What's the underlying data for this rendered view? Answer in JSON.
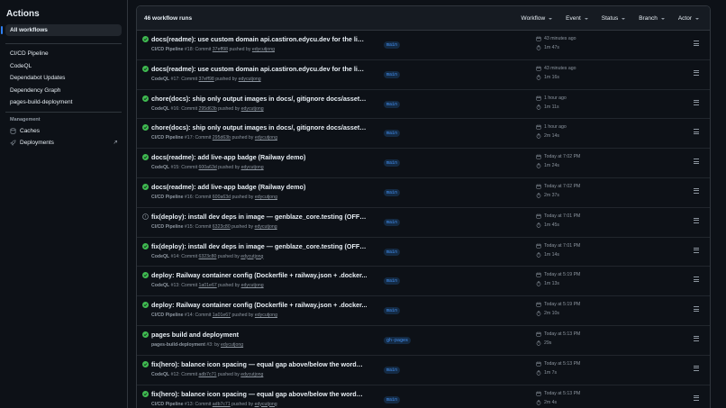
{
  "sidebar": {
    "title": "Actions",
    "all_workflows": "All workflows",
    "workflows": [
      "CI/CD Pipeline",
      "CodeQL",
      "Dependabot Updates",
      "Dependency Graph",
      "pages-build-deployment"
    ],
    "management_title": "Management",
    "management": [
      {
        "label": "Caches",
        "icon": "cache-icon"
      },
      {
        "label": "Deployments",
        "icon": "rocket-icon"
      }
    ]
  },
  "main": {
    "runs_count": "46 workflow runs",
    "filters": [
      "Workflow",
      "Event",
      "Status",
      "Branch",
      "Actor"
    ]
  },
  "runs": [
    {
      "status": "success",
      "title": "docs(readme): use custom domain api.castiron.edycu.dev for the live app",
      "workflow": "CI/CD Pipeline",
      "run": "#18",
      "kind": "Commit",
      "commit": "37eff98",
      "actor": "edycutjong",
      "branch": "main",
      "time": "43 minutes ago",
      "duration": "1m 47s"
    },
    {
      "status": "success",
      "title": "docs(readme): use custom domain api.castiron.edycu.dev for the live app",
      "workflow": "CodeQL",
      "run": "#17",
      "kind": "Commit",
      "commit": "37eff98",
      "actor": "edycutjong",
      "branch": "main",
      "time": "43 minutes ago",
      "duration": "1m 16s"
    },
    {
      "status": "success",
      "title": "chore(docs): ship only output images in docs/, gitignore docs/assets ...",
      "workflow": "CodeQL",
      "run": "#16",
      "kind": "Commit",
      "commit": "295d63b",
      "actor": "edycutjong",
      "branch": "main",
      "time": "1 hour ago",
      "duration": "1m 11s"
    },
    {
      "status": "success",
      "title": "chore(docs): ship only output images in docs/, gitignore docs/assets ...",
      "workflow": "CI/CD Pipeline",
      "run": "#17",
      "kind": "Commit",
      "commit": "295d63b",
      "actor": "edycutjong",
      "branch": "main",
      "time": "1 hour ago",
      "duration": "2m 14s"
    },
    {
      "status": "success",
      "title": "docs(readme): add live-app badge (Railway demo)",
      "workflow": "CodeQL",
      "run": "#15",
      "kind": "Commit",
      "commit": "600a63d",
      "actor": "edycutjong",
      "branch": "main",
      "time": "Today at 7:02 PM",
      "duration": "1m 24s"
    },
    {
      "status": "success",
      "title": "docs(readme): add live-app badge (Railway demo)",
      "workflow": "CI/CD Pipeline",
      "run": "#16",
      "kind": "Commit",
      "commit": "600a63d",
      "actor": "edycutjong",
      "branch": "main",
      "time": "Today at 7:02 PM",
      "duration": "2m 37s"
    },
    {
      "status": "neutral",
      "title": "fix(deploy): install dev deps in image — genblaze_core.testing (OFFLI...",
      "workflow": "CI/CD Pipeline",
      "run": "#15",
      "kind": "Commit",
      "commit": "6323c80",
      "actor": "edycutjong",
      "branch": "main",
      "time": "Today at 7:01 PM",
      "duration": "1m 45s"
    },
    {
      "status": "success",
      "title": "fix(deploy): install dev deps in image — genblaze_core.testing (OFFLI...",
      "workflow": "CodeQL",
      "run": "#14",
      "kind": "Commit",
      "commit": "6323c80",
      "actor": "edycutjong",
      "branch": "main",
      "time": "Today at 7:01 PM",
      "duration": "1m 14s"
    },
    {
      "status": "success",
      "title": "deploy: Railway container config (Dockerfile + railway.json + .docker...",
      "workflow": "CodeQL",
      "run": "#13",
      "kind": "Commit",
      "commit": "1a01e67",
      "actor": "edycutjong",
      "branch": "main",
      "time": "Today at 5:19 PM",
      "duration": "1m 13s"
    },
    {
      "status": "success",
      "title": "deploy: Railway container config (Dockerfile + railway.json + .docker...",
      "workflow": "CI/CD Pipeline",
      "run": "#14",
      "kind": "Commit",
      "commit": "1a01e67",
      "actor": "edycutjong",
      "branch": "main",
      "time": "Today at 5:19 PM",
      "duration": "2m 10s"
    },
    {
      "status": "success",
      "title": "pages build and deployment",
      "workflow": "pages-build-deployment",
      "run": "#3",
      "kind": "",
      "commit": "",
      "actor": "edycutjong",
      "branch": "gh-pages",
      "time": "Today at 5:13 PM",
      "duration": "29s"
    },
    {
      "status": "success",
      "title": "fix(hero): balance icon spacing — equal gap above/below the wordmark",
      "workflow": "CodeQL",
      "run": "#12",
      "kind": "Commit",
      "commit": "adb7c71",
      "actor": "edycutjong",
      "branch": "main",
      "time": "Today at 5:13 PM",
      "duration": "1m 7s"
    },
    {
      "status": "success",
      "title": "fix(hero): balance icon spacing — equal gap above/below the wordmark",
      "workflow": "CI/CD Pipeline",
      "run": "#13",
      "kind": "Commit",
      "commit": "adb7c71",
      "actor": "edycutjong",
      "branch": "main",
      "time": "Today at 5:13 PM",
      "duration": "2m 4s"
    }
  ],
  "text": {
    "pushed_by": "pushed by",
    "by": "by"
  },
  "colors": {
    "success": "#3fb950",
    "neutral": "#8d96a0",
    "accent": "#2f81f7",
    "branch_text": "#4493f8"
  }
}
